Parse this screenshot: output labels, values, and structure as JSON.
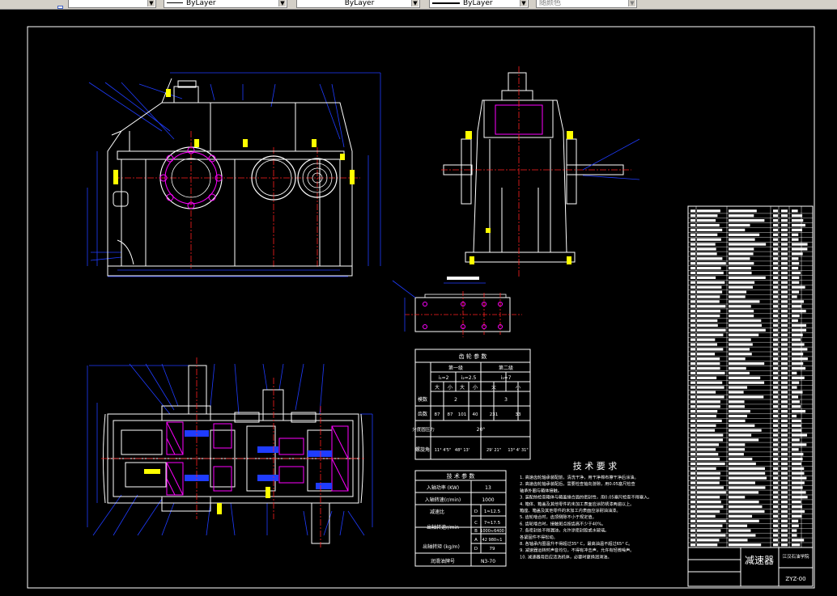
{
  "toolbar": {
    "linetype_value": "ByLayer",
    "lineweight_value": "ByLayer",
    "color_value": "ByLayer",
    "plotstyle_value": "随颜色"
  },
  "gear_params": {
    "title": "齿 轮 参 数",
    "stage1": "第一级",
    "stage2": "第二级",
    "i1": "i₁=2",
    "i2": "i₂=2.5",
    "i3": "i₃=7",
    "big": "大",
    "small": "小",
    "row_module": "模数",
    "module_1": "2",
    "module_2": "3",
    "row_teeth": "齿数",
    "teeth": [
      "87",
      "87",
      "101",
      "40",
      "231",
      "33"
    ],
    "row_pressure": "分度圆压力",
    "pressure": "20°",
    "row_helix": "螺旋角",
    "helix": [
      "11° 4'5\"",
      "48° 13'",
      "29' 21\"",
      "13° 4' 31\""
    ]
  },
  "tech_params": {
    "title": "技 术 参 数",
    "rows": [
      {
        "label": "入轴功率 (KW)",
        "value": "13"
      },
      {
        "label": "入轴转速(r/min)",
        "value": "1000"
      },
      {
        "label": "减速比",
        "sub": [
          "D",
          "C",
          "B",
          "A"
        ],
        "vals": [
          "1≈12.5",
          "7≈17.5",
          "1000≈6400",
          "42 980≈1"
        ]
      },
      {
        "label": "出轴转速r/min",
        "sub": [],
        "vals": []
      },
      {
        "label": "出轴转矩 (kg/m)",
        "sub": [
          "B",
          "D"
        ],
        "vals": [
          "12",
          "79"
        ]
      },
      {
        "label": "润滑油牌号",
        "value": "N3-70"
      }
    ]
  },
  "tech_req": {
    "title": "技 术 要 求",
    "lines": [
      "1. 高速齿轮轴承装配前，清洗干净，用干净棉布擦干净后涂油。",
      "2. 高速齿轮轴承装配后，需要检查轴向游隙，用0.05塞尺检查",
      "   轴承外圈与箱体接触。",
      "3. 装配前检查箱体与箱盖接合面的密封性，用0.05塞尺检查不得塞入。",
      "4. 箱体、箱盖及其他零件的未加工表面应涂防锈漆两遍以上。",
      "   箱座、箱盖及其他零件的未加工内表面应涂耐油油漆。",
      "5. 齿轮啮合时，齿顶侧隙不小于规定值。",
      "6. 齿轮啮合时，接触斑点按齿高不少于40%。",
      "7. 各密封处不得漏油，允许涂密封胶或水玻璃。",
      "   各紧固件不得松动。",
      "8. 各轴承内圈温升不得超过35° C，最高油温不超过65° C。",
      "9. 减速器运转时声音均匀，不得有冲击声，允许有轻微噪声。",
      "10. 减速器用后应清洗机体，必要时更换润滑油。"
    ]
  },
  "title_block": {
    "name": "减速器",
    "school": "江汉石油学院",
    "code": "ZYZ-00"
  },
  "colors": {
    "outline": "#ffffff",
    "centerline": "#ff2020",
    "dimension": "#1f3cff",
    "hatch": "#ff00ff",
    "bolt": "#ffff00"
  }
}
